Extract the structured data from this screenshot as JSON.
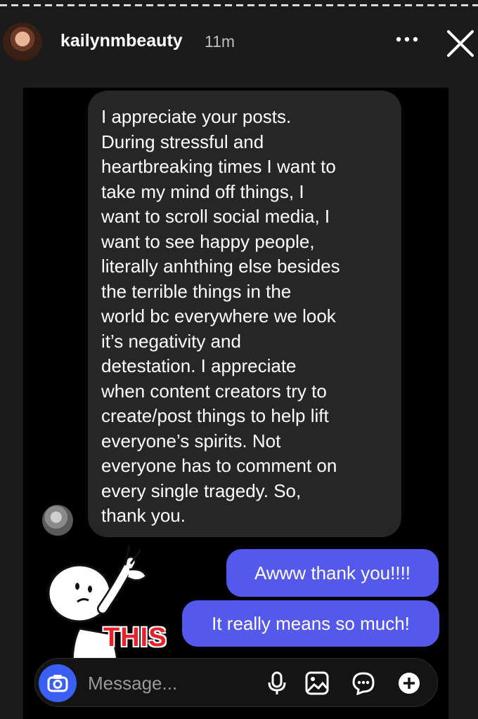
{
  "story": {
    "username": "kailynmbeauty",
    "time_ago": "11m",
    "avatar_icon": "profile-photo",
    "more_icon": "ellipsis-icon",
    "close_icon": "close-icon"
  },
  "dm": {
    "received_message": "I appreciate your posts.\nDuring stressful and\nheartbreaking times I want to\ntake my mind off things, I\nwant to scroll social media, I\nwant to see happy people,\nliterally anhthing else besides\nthe terrible things in the\nworld bc everywhere we look\nit’s negativity and\ndetestation. I appreciate\nwhen content creators try to\ncreate/post things to help lift\neveryone’s spirits. Not\neveryone has to comment on\nevery single tragedy. So,\nthank you.",
    "sent_messages": [
      "Awww thank you!!!!",
      "It really means so much!"
    ],
    "sticker_text": "THIS",
    "composer": {
      "placeholder": "Message...",
      "icons": [
        "camera-icon",
        "microphone-icon",
        "gallery-icon",
        "sticker-icon",
        "plus-icon"
      ]
    }
  },
  "colors": {
    "sent_bubble": "#5458eb",
    "received_bubble": "#262626",
    "camera_button": "#3a5ff2",
    "sticker_text": "#e8202a"
  }
}
